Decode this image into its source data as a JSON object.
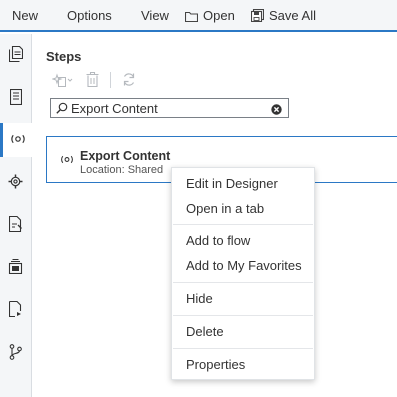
{
  "menubar": {
    "new_label": "New",
    "options_label": "Options",
    "view_label": "View",
    "open_label": "Open",
    "save_all_label": "Save All"
  },
  "sidebar": {
    "items": [
      {
        "name": "document",
        "icon": "document-icon"
      },
      {
        "name": "form",
        "icon": "form-icon"
      },
      {
        "name": "steps",
        "icon": "steps-icon",
        "active": true
      },
      {
        "name": "settings",
        "icon": "gear-icon"
      },
      {
        "name": "file-edit",
        "icon": "file-edit-icon"
      },
      {
        "name": "library",
        "icon": "library-icon"
      },
      {
        "name": "file-run",
        "icon": "file-run-icon"
      },
      {
        "name": "git",
        "icon": "git-branch-icon"
      }
    ]
  },
  "steps_panel": {
    "title": "Steps",
    "toolbar": {
      "new_step": "new-step-icon",
      "delete": "delete-icon",
      "refresh": "refresh-icon"
    },
    "search": {
      "value": "Export Content",
      "placeholder": ""
    },
    "result": {
      "title": "Export Content",
      "subtitle": "Location: Shared"
    }
  },
  "context_menu": {
    "items": [
      "Edit in Designer",
      "Open in a tab",
      "Add to flow",
      "Add to My Favorites",
      "Hide",
      "Delete",
      "Properties"
    ]
  },
  "colors": {
    "accent": "#2b78c5",
    "sidebar_bg": "#f4f6f8",
    "text": "#333333"
  }
}
